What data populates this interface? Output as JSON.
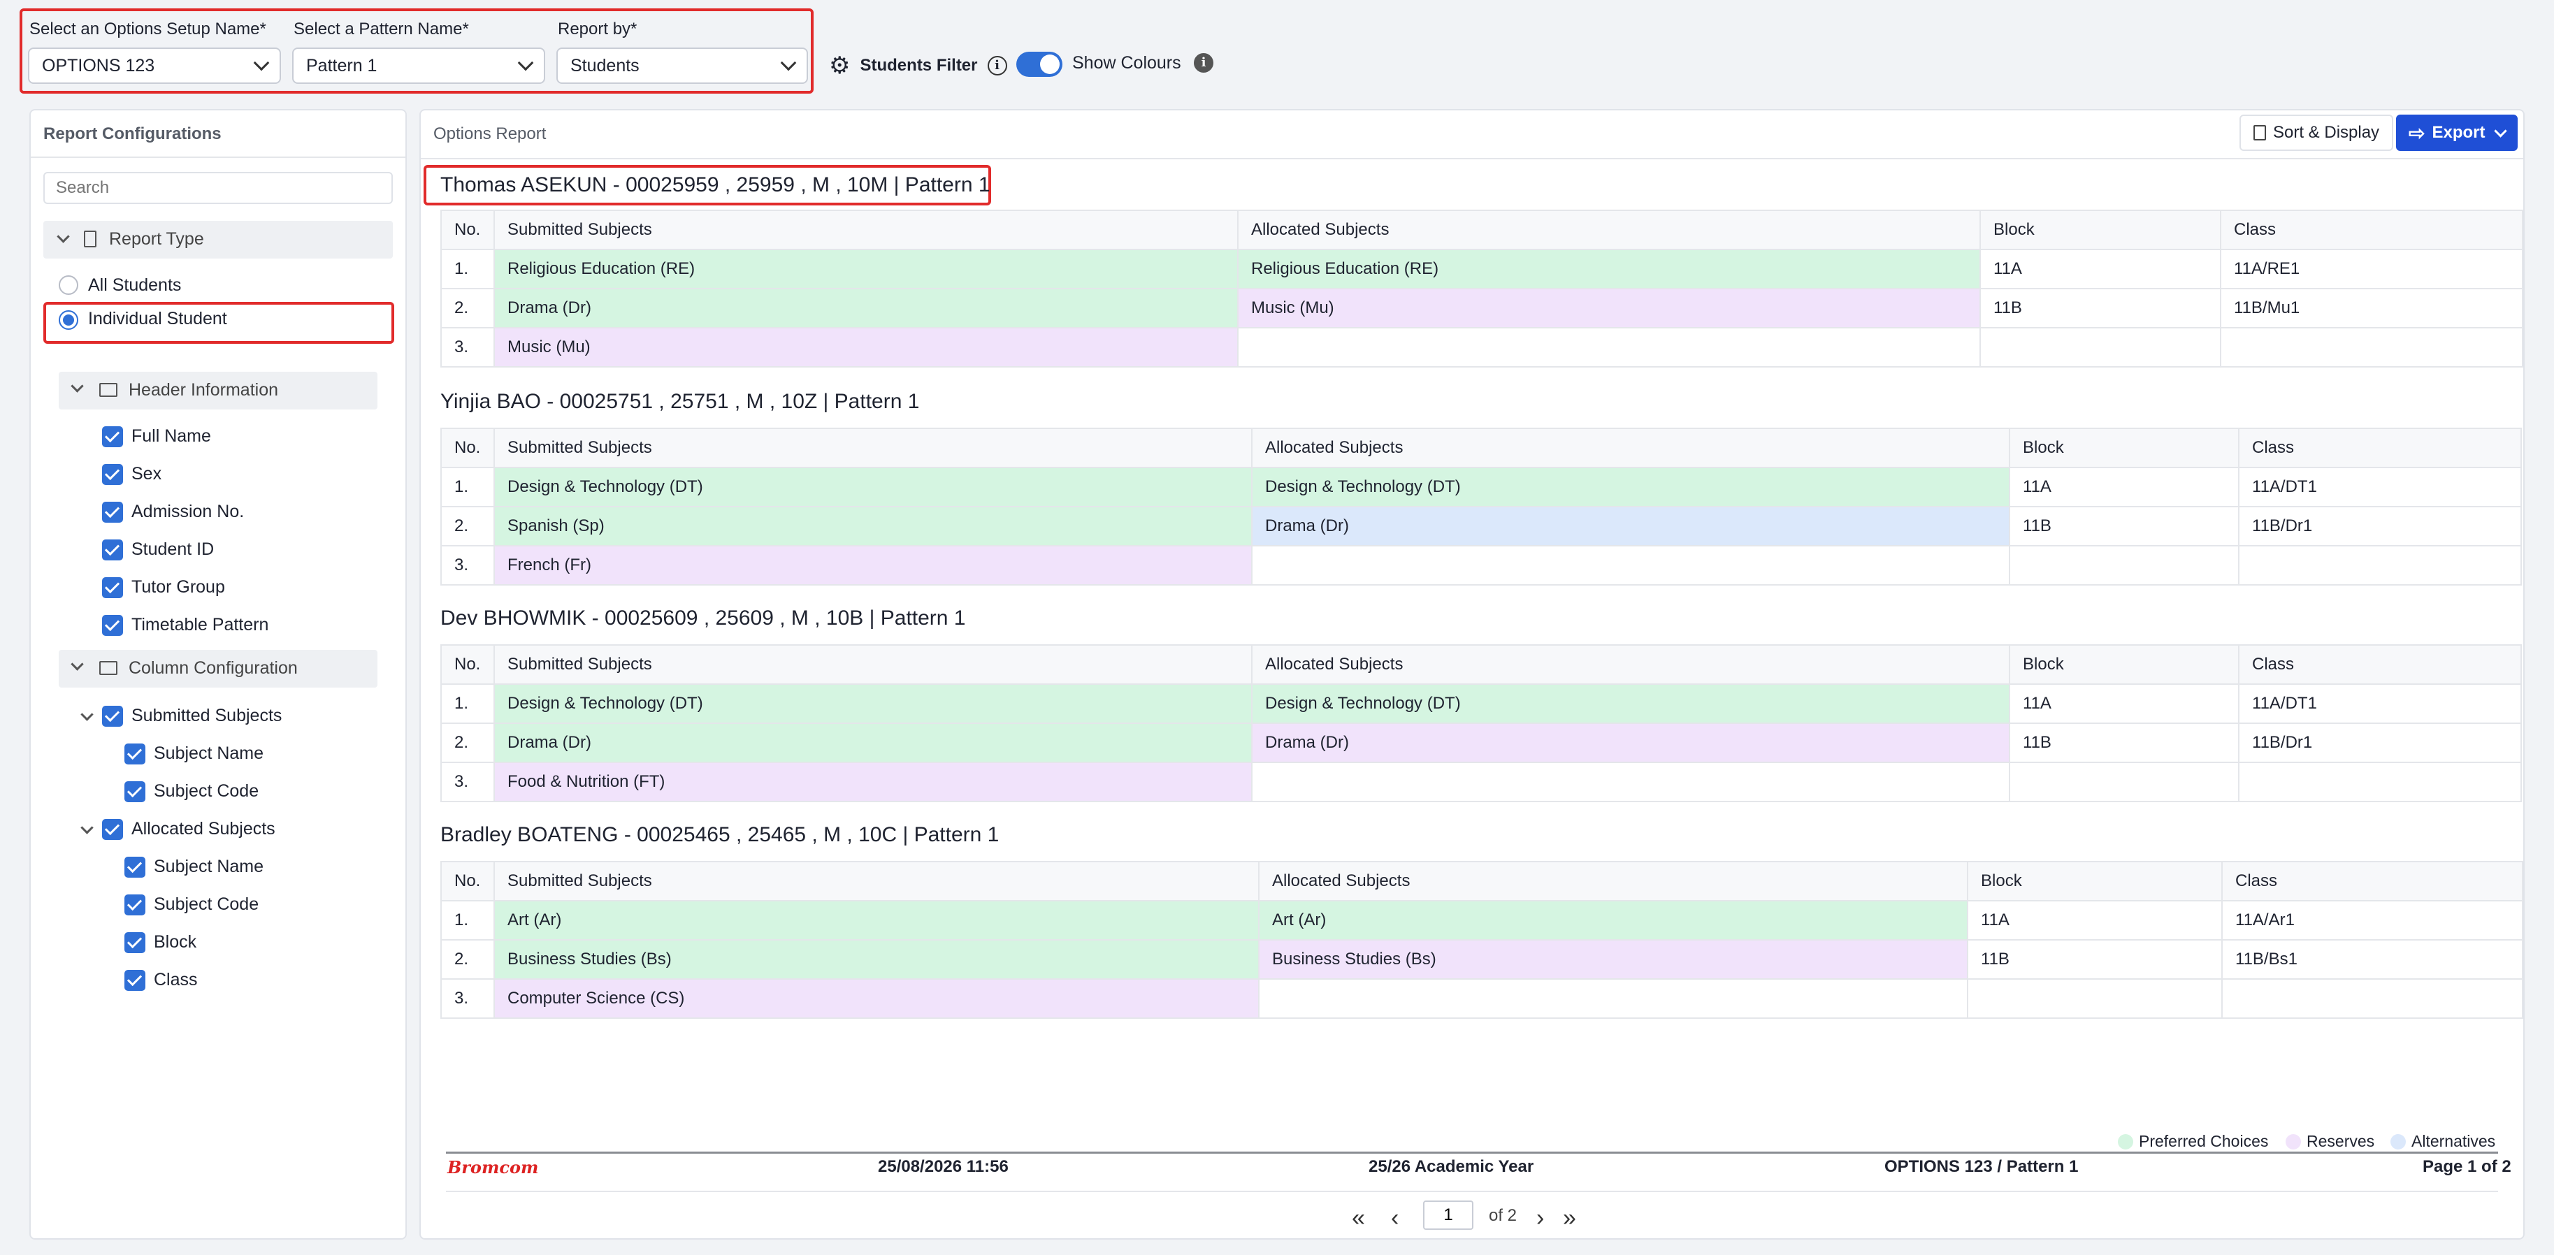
{
  "filters": {
    "options_setup": {
      "label": "Select an Options Setup Name*",
      "value": "OPTIONS 123"
    },
    "pattern": {
      "label": "Select a Pattern Name*",
      "value": "Pattern 1"
    },
    "report_by": {
      "label": "Report by*",
      "value": "Students"
    },
    "students_filter": "Students Filter",
    "show_colours": "Show Colours"
  },
  "sidebar": {
    "title": "Report Configurations",
    "search_placeholder": "Search",
    "report_type": "Report Type",
    "all_students": "All Students",
    "individual_student": "Individual Student",
    "header_info": "Header Information",
    "header_items": [
      "Full Name",
      "Sex",
      "Admission No.",
      "Student ID",
      "Tutor Group",
      "Timetable Pattern"
    ],
    "column_config": "Column Configuration",
    "submitted": "Submitted Subjects",
    "submitted_items": [
      "Subject Name",
      "Subject Code"
    ],
    "allocated": "Allocated Subjects",
    "allocated_items": [
      "Subject Name",
      "Subject Code",
      "Block",
      "Class"
    ]
  },
  "main": {
    "title": "Options Report",
    "sort_display": "Sort & Display",
    "export": "Export",
    "columns": [
      "No.",
      "Submitted Subjects",
      "Allocated Subjects",
      "Block",
      "Class"
    ],
    "students": [
      {
        "header": "Thomas ASEKUN - 00025959 , 25959 , M , 10M  |  Pattern 1",
        "rows": [
          [
            "1.",
            "Religious Education (RE)",
            "Religious Education (RE)",
            "11A",
            "11A/RE1"
          ],
          [
            "2.",
            "Drama (Dr)",
            "Music (Mu)",
            "11B",
            "11B/Mu1"
          ],
          [
            "3.",
            "Music (Mu)",
            "",
            "",
            ""
          ]
        ]
      },
      {
        "header": "Yinjia BAO - 00025751 , 25751 , M , 10Z  |  Pattern 1",
        "rows": [
          [
            "1.",
            "Design & Technology (DT)",
            "Design & Technology (DT)",
            "11A",
            "11A/DT1"
          ],
          [
            "2.",
            "Spanish (Sp)",
            "Drama (Dr)",
            "11B",
            "11B/Dr1"
          ],
          [
            "3.",
            "French (Fr)",
            "",
            "",
            ""
          ]
        ]
      },
      {
        "header": "Dev BHOWMIK - 00025609 , 25609 , M , 10B  |  Pattern 1",
        "rows": [
          [
            "1.",
            "Design & Technology (DT)",
            "Design & Technology (DT)",
            "11A",
            "11A/DT1"
          ],
          [
            "2.",
            "Drama (Dr)",
            "Drama (Dr)",
            "11B",
            "11B/Dr1"
          ],
          [
            "3.",
            "Food & Nutrition (FT)",
            "",
            "",
            ""
          ]
        ]
      },
      {
        "header": "Bradley BOATENG - 00025465 , 25465 , M , 10C  |  Pattern 1",
        "rows": [
          [
            "1.",
            "Art (Ar)",
            "Art (Ar)",
            "11A",
            "11A/Ar1"
          ],
          [
            "2.",
            "Business Studies (Bs)",
            "Business Studies (Bs)",
            "11B",
            "11B/Bs1"
          ],
          [
            "3.",
            "Computer Science (CS)",
            "",
            "",
            ""
          ]
        ]
      }
    ],
    "legend": [
      "Preferred Choices",
      "Reserves",
      "Alternatives"
    ],
    "footer": {
      "brand": "Bromcom",
      "date": "25/08/2026 11:56",
      "year": "25/26 Academic Year",
      "setup": "OPTIONS 123 / Pattern 1",
      "page": "Page 1 of 2"
    },
    "pager": {
      "current": "1",
      "of": "of 2"
    }
  },
  "colors": {
    "preferred": "#d5f5e1",
    "reserve": "#f1e3fb",
    "alternative": "#dbe8fb",
    "accent": "#2f6fd6",
    "export": "#1f4fd6"
  }
}
